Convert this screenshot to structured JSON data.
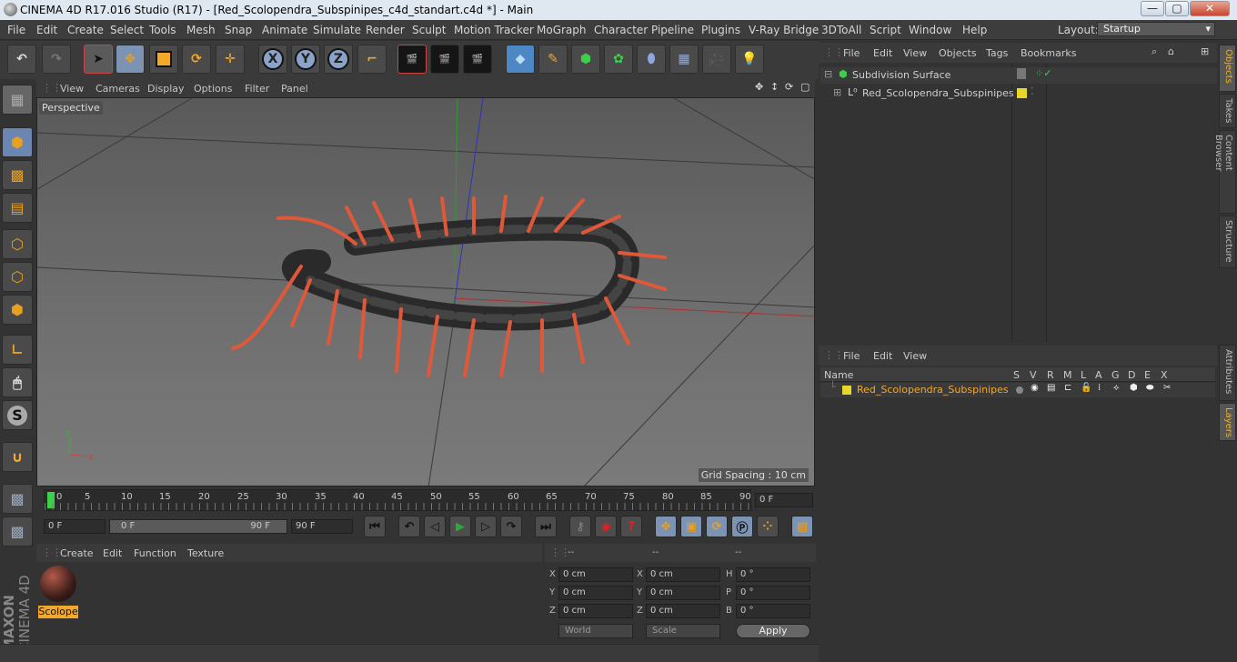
{
  "window": {
    "title": "CINEMA 4D R17.016 Studio (R17) - [Red_Scolopendra_Subspinipes_c4d_standart.c4d *] - Main",
    "min": "—",
    "max": "▢",
    "close": "✕"
  },
  "menubar": [
    "File",
    "Edit",
    "Create",
    "Select",
    "Tools",
    "Mesh",
    "Snap",
    "Animate",
    "Simulate",
    "Render",
    "Sculpt",
    "Motion Tracker",
    "MoGraph",
    "Character",
    "Pipeline",
    "Plugins",
    "V-Ray Bridge",
    "3DToAll",
    "Script",
    "Window",
    "Help"
  ],
  "layout": {
    "label": "Layout:",
    "value": "Startup"
  },
  "toolbar": {
    "x": "X",
    "y": "Y",
    "z": "Z"
  },
  "viewport": {
    "menu": [
      "View",
      "Cameras",
      "Display",
      "Options",
      "Filter",
      "Panel"
    ],
    "label": "Perspective",
    "grid_spacing": "Grid Spacing : 10 cm"
  },
  "timeline": {
    "ticks": [
      "0",
      "5",
      "10",
      "15",
      "20",
      "25",
      "30",
      "35",
      "40",
      "45",
      "50",
      "55",
      "60",
      "65",
      "70",
      "75",
      "80",
      "85",
      "90"
    ],
    "current_frame": "0 F"
  },
  "transport": {
    "start": "0 F",
    "range_start": "0 F",
    "range_end": "90 F",
    "end": "90 F"
  },
  "material_menu": [
    "Create",
    "Edit",
    "Function",
    "Texture"
  ],
  "material": {
    "name": "Scolope"
  },
  "coordinates": {
    "headers": [
      "--",
      "--",
      "--"
    ],
    "rows": [
      {
        "a": "X",
        "av": "0 cm",
        "b": "X",
        "bv": "0 cm",
        "c": "H",
        "cv": "0 °"
      },
      {
        "a": "Y",
        "av": "0 cm",
        "b": "Y",
        "bv": "0 cm",
        "c": "P",
        "cv": "0 °"
      },
      {
        "a": "Z",
        "av": "0 cm",
        "b": "Z",
        "bv": "0 cm",
        "c": "B",
        "cv": "0 °"
      }
    ],
    "world": "World",
    "scale": "Scale",
    "apply": "Apply"
  },
  "objects_menu": [
    "File",
    "Edit",
    "View",
    "Objects",
    "Tags",
    "Bookmarks"
  ],
  "objects": [
    {
      "name": "Subdivision Surface"
    },
    {
      "name": "Red_Scolopendra_Subspinipes"
    }
  ],
  "layers_menu": [
    "File",
    "Edit",
    "View"
  ],
  "layers_header": [
    "Name",
    "S",
    "V",
    "R",
    "M",
    "L",
    "A",
    "G",
    "D",
    "E",
    "X"
  ],
  "layers": [
    {
      "name": "Red_Scolopendra_Subspinipes"
    }
  ],
  "right_tabs": [
    "Objects",
    "Takes",
    "Content Browser",
    "Structure",
    "Attributes",
    "Layers"
  ],
  "brand": {
    "maxon": "MAXON",
    "c4d": "CINEMA 4D"
  },
  "colors": {
    "accent": "#f4a82a",
    "layer_yellow": "#e8d62a",
    "selection_blue": "#7d93b4"
  }
}
